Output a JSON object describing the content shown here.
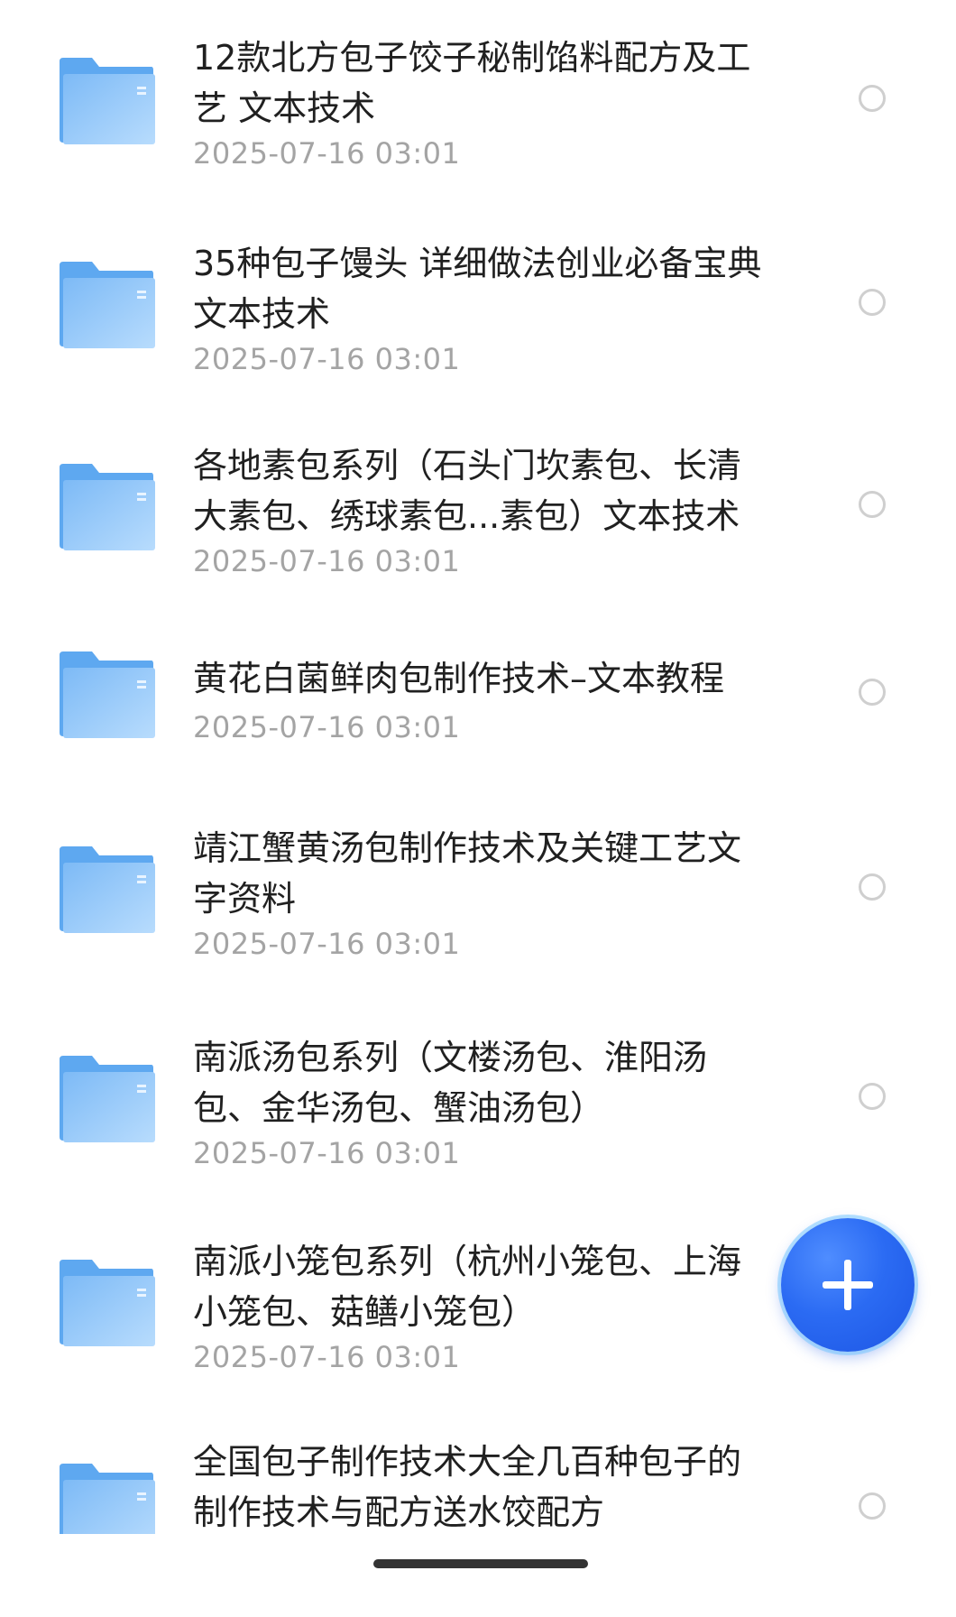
{
  "files": [
    {
      "name": "12款北方包子饺子秘制馅料配方及工艺 文本技术",
      "date": "2025-07-16 03:01"
    },
    {
      "name": "35种包子馒头 详细做法创业必备宝典 文本技术",
      "date": "2025-07-16 03:01"
    },
    {
      "name": "各地素包系列（石头门坎素包、长清大素包、绣球素包...素包）文本技术",
      "date": "2025-07-16 03:01"
    },
    {
      "name": "黄花白菌鲜肉包制作技术–文本教程",
      "date": "2025-07-16 03:01"
    },
    {
      "name": "靖江蟹黄汤包制作技术及关键工艺文字资料",
      "date": "2025-07-16 03:01"
    },
    {
      "name": "南派汤包系列（文楼汤包、淮阳汤包、金华汤包、蟹油汤包）",
      "date": "2025-07-16 03:01"
    },
    {
      "name": "南派小笼包系列（杭州小笼包、上海小笼包、菇鳝小笼包）",
      "date": "2025-07-16 03:01"
    },
    {
      "name": "全国包子制作技术大全几百种包子的制作技术与配方送水饺配方",
      "date": ""
    }
  ],
  "icons": {
    "folder": "folder-icon",
    "select": "radio-unchecked-icon",
    "fab": "plus-icon"
  },
  "colors": {
    "folder_light": "#a9d4fb",
    "folder_dark": "#5ea8f0",
    "fab": "#2b6bf3",
    "date_text": "#a4a4a4"
  }
}
